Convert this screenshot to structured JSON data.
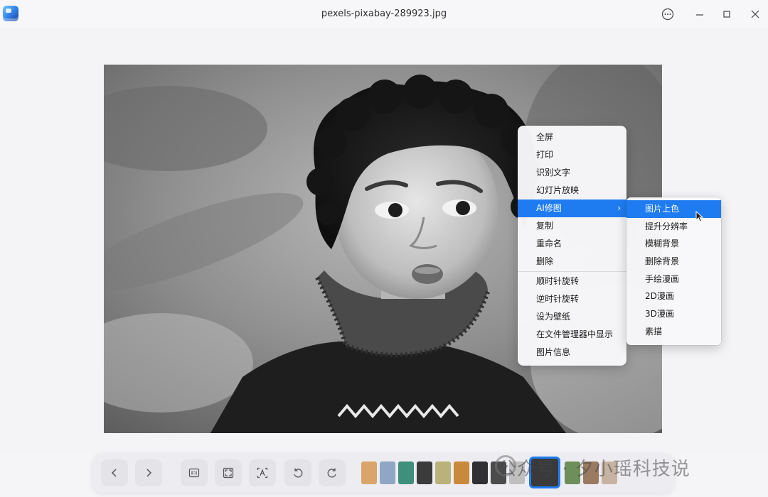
{
  "window": {
    "title": "pexels-pixabay-289923.jpg",
    "icons": [
      "app-icon",
      "more-icon",
      "minimize-icon",
      "maximize-icon",
      "close-icon"
    ]
  },
  "context_menu": {
    "items": [
      {
        "label": "全屏"
      },
      {
        "label": "打印"
      },
      {
        "label": "识别文字"
      },
      {
        "label": "幻灯片放映"
      },
      {
        "label": "AI修图",
        "active": true,
        "has_submenu": true
      },
      {
        "label": "复制"
      },
      {
        "label": "重命名"
      },
      {
        "label": "删除"
      },
      {
        "label": "顺时针旋转"
      },
      {
        "label": "逆时针旋转"
      },
      {
        "label": "设为壁纸"
      },
      {
        "label": "在文件管理器中显示"
      },
      {
        "label": "图片信息"
      }
    ],
    "submenu_arrow": "›"
  },
  "ai_submenu": {
    "items": [
      {
        "label": "图片上色",
        "active": true
      },
      {
        "label": "提升分辨率"
      },
      {
        "label": "模糊背景"
      },
      {
        "label": "删除背景"
      },
      {
        "label": "手绘漫画"
      },
      {
        "label": "2D漫画"
      },
      {
        "label": "3D漫画"
      },
      {
        "label": "素描"
      }
    ]
  },
  "toolbar": {
    "buttons": [
      {
        "name": "previous-button",
        "icon": "chevron-left-icon"
      },
      {
        "name": "next-button",
        "icon": "chevron-right-icon"
      },
      {
        "name": "original-size-button",
        "icon": "one-to-one-icon"
      },
      {
        "name": "fit-window-button",
        "icon": "fit-window-icon"
      },
      {
        "name": "ocr-button",
        "icon": "text-recognition-icon"
      },
      {
        "name": "rotate-counterclockwise-button",
        "icon": "rotate-left-icon"
      },
      {
        "name": "rotate-clockwise-button",
        "icon": "rotate-right-icon"
      }
    ],
    "thumbnail_colors": [
      "#d9a56a",
      "#8fa7c4",
      "#3f8f7d",
      "#3b3b3b",
      "#b9b27a",
      "#c9893b",
      "#2f2f34",
      "#4b4b4b",
      "#bfbfbf",
      "#3a3a3a",
      "#6f8f5a",
      "#9a7b62",
      "#c7b3a1"
    ]
  },
  "watermark": {
    "text": "公众号 · 夕小瑶科技说"
  },
  "colors": {
    "accent": "#1f7cf0"
  }
}
